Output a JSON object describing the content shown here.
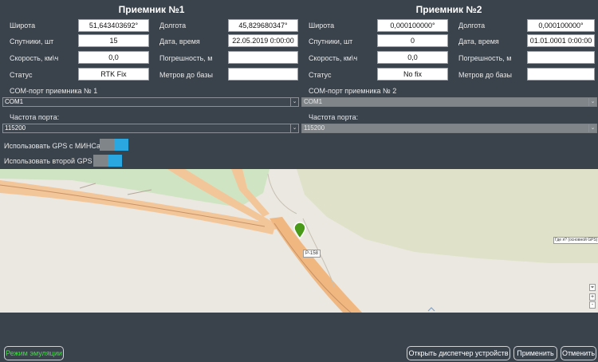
{
  "receiver1": {
    "title": "Приемник №1",
    "lat_label": "Широта",
    "lat_value": "51,643403692°",
    "lon_label": "Долгота",
    "lon_value": "45,829680347°",
    "sats_label": "Спутники, шт",
    "sats_value": "15",
    "datetime_label": "Дата, время",
    "datetime_value": "22.05.2019 0:00:00",
    "speed_label": "Скорость, км\\ч",
    "speed_value": "0,0",
    "error_label": "Погрешность, м",
    "error_value": "",
    "status_label": "Статус",
    "status_value": "RTK Fix",
    "meters_label": "Метров до базы",
    "meters_value": "",
    "com_label": "COM-порт приемника №  1",
    "com_value": "COM1",
    "baud_label": "Частота порта:",
    "baud_value": "115200"
  },
  "receiver2": {
    "title": "Приемник №2",
    "lat_label": "Широта",
    "lat_value": "0,000100000°",
    "lon_label": "Долгота",
    "lon_value": "0,000100000°",
    "sats_label": "Спутники, шт",
    "sats_value": "0",
    "datetime_label": "Дата, время",
    "datetime_value": "01.01.0001 0:00:00",
    "speed_label": "Скорость, км\\ч",
    "speed_value": "0,0",
    "error_label": "Погрешность, м",
    "error_value": "",
    "status_label": "Статус",
    "status_value": "No fix",
    "meters_label": "Метров до базы",
    "meters_value": "",
    "com_label": "COM-порт приемника №  2",
    "com_value": "COM1",
    "baud_label": "Частота порта:",
    "baud_value": "115200"
  },
  "toggles": {
    "use_gps_minsa": "Использовать GPS с МИНСа",
    "use_second_gps": "Использовать второй GPS"
  },
  "map": {
    "road_label": "Р-158",
    "tooltip": "Где я? (основной GPS)",
    "zoom_in": "+",
    "zoom_out": "-",
    "marker_icon": "map-pin-icon"
  },
  "buttons": {
    "emulation": "Режим эмуляции",
    "open_device_manager": "Открыть диспетчер устройств",
    "apply": "Применить",
    "cancel": "Отменить"
  },
  "colors": {
    "background": "#3a424c",
    "toggle_on": "#2aa6e0",
    "emulation_text": "#3ee03e",
    "marker": "#4a9a1a"
  }
}
